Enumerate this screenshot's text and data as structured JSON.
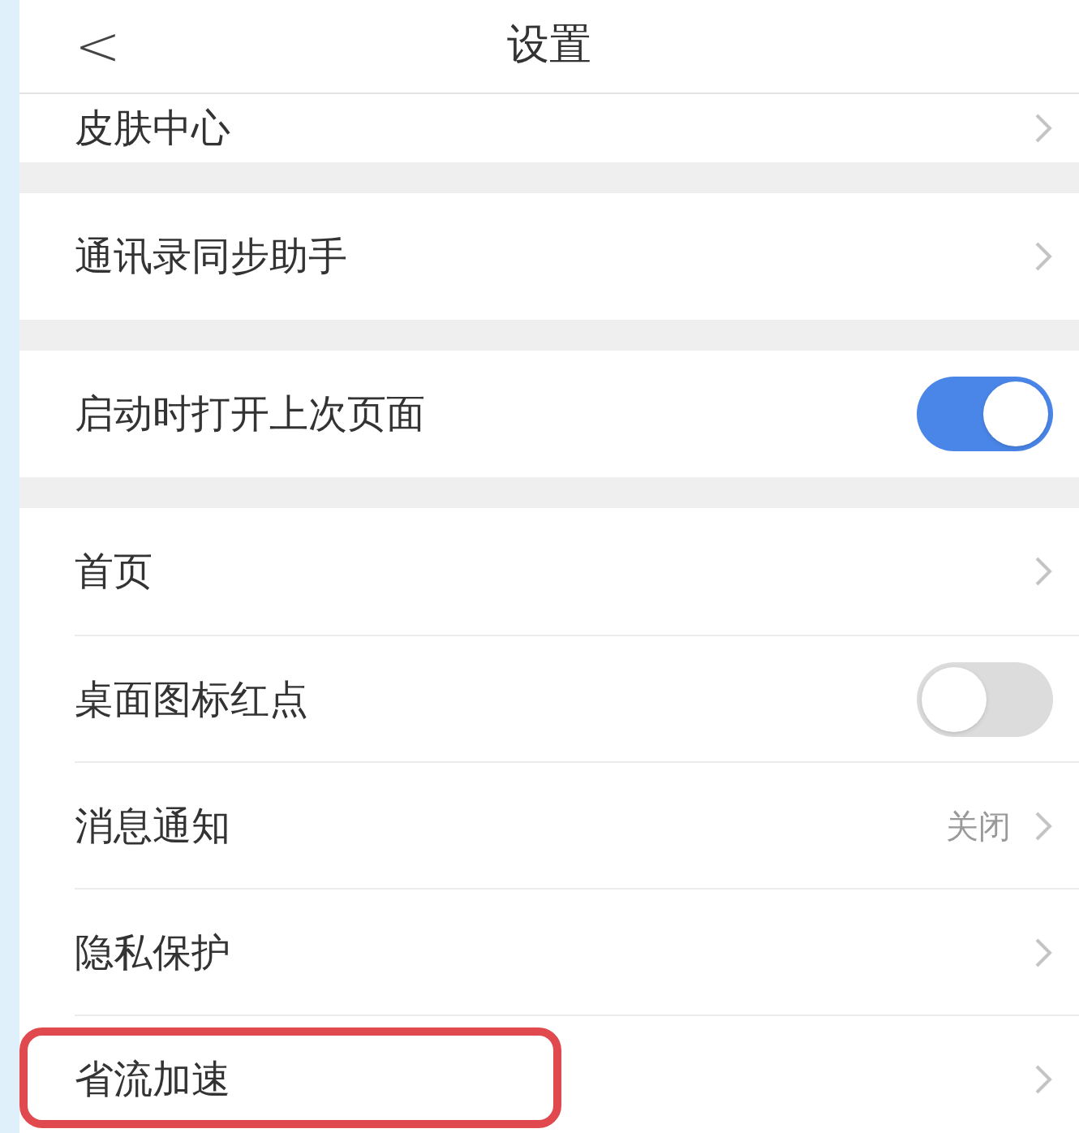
{
  "header": {
    "back": "<",
    "title": "设置"
  },
  "sections": [
    {
      "items": [
        {
          "kind": "link",
          "label": "皮肤中心",
          "highlighted": false
        }
      ]
    },
    {
      "items": [
        {
          "kind": "link",
          "label": "通讯录同步助手",
          "highlighted": false
        }
      ]
    },
    {
      "items": [
        {
          "kind": "toggle",
          "label": "启动时打开上次页面",
          "on": true,
          "highlighted": false
        }
      ]
    },
    {
      "items": [
        {
          "kind": "link",
          "label": "首页",
          "highlighted": false
        },
        {
          "kind": "toggle",
          "label": "桌面图标红点",
          "on": false,
          "highlighted": false
        },
        {
          "kind": "link",
          "label": "消息通知",
          "value": "关闭",
          "highlighted": false
        },
        {
          "kind": "link",
          "label": "隐私保护",
          "highlighted": false
        },
        {
          "kind": "link",
          "label": "省流加速",
          "highlighted": true
        }
      ]
    }
  ]
}
